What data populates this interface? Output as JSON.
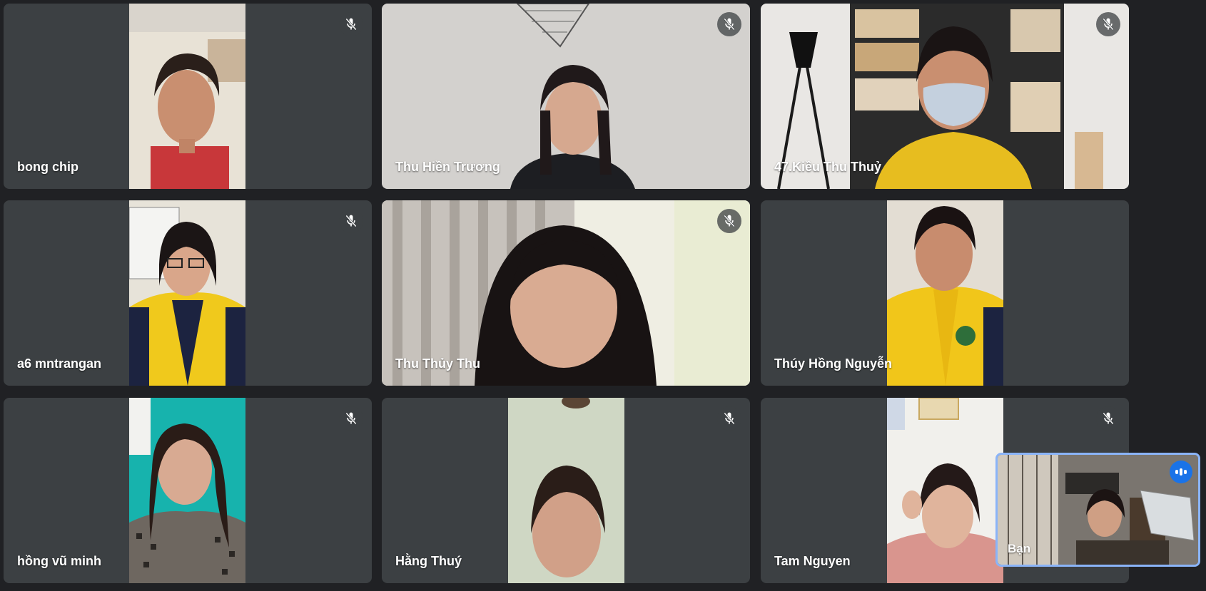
{
  "meeting": {
    "participants": [
      {
        "name": "bong chip",
        "muted": true
      },
      {
        "name": "Thu Hiền Trương",
        "muted": true
      },
      {
        "name": "47.Kiều Thu Thuỷ",
        "muted": true
      },
      {
        "name": "a6 mntrangan",
        "muted": true
      },
      {
        "name": "Thu Thủy Thu",
        "muted": true
      },
      {
        "name": "Thúy Hồng Nguyễn",
        "muted": false
      },
      {
        "name": "hồng vũ minh",
        "muted": true
      },
      {
        "name": "Hằng Thuý",
        "muted": true
      },
      {
        "name": "Tam Nguyen",
        "muted": true
      }
    ],
    "self_view": {
      "name": "Bạn",
      "speaking_indicator": "speaking-icon",
      "border_color": "#8ab4f8"
    },
    "icons": {
      "muted": "mic-off-icon"
    },
    "colors": {
      "background": "#202124",
      "tile": "#3c4043",
      "accent": "#1a73e8"
    }
  }
}
